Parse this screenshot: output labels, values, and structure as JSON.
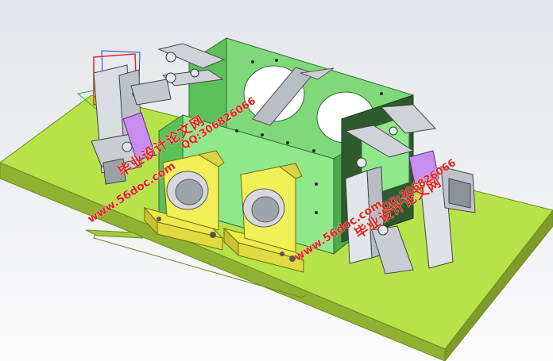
{
  "scene": {
    "subject": "3D CAD model of a welding/inspection fixture on a base plate",
    "colors": {
      "background_top": "#e3e6ea",
      "background_bottom": "#fbfbfc",
      "base_plate": "#b7e34a",
      "base_plate_side": "#8fb232",
      "housing": "#8fe88a",
      "housing_dark": "#5cc05a",
      "bearing_block": "#f2ef57",
      "bearing_block_shadow": "#c9c332",
      "clamp_grey": "#d2d6dc",
      "clamp_dark": "#8b9099",
      "cylinder_purple": "#c78df0",
      "dark_green_panel": "#2e5a2d",
      "triad_red": "#e22828",
      "triad_green": "#2bb32b",
      "triad_blue": "#2a3fd8"
    }
  },
  "watermarks": {
    "left": {
      "url": "www.56doc.com",
      "qq": "QQ:306826066",
      "site": "毕业设计论文网"
    },
    "right": {
      "url": "www.56doc.com",
      "qq": "QQ:306826066",
      "site": "毕业设计论文网"
    }
  }
}
